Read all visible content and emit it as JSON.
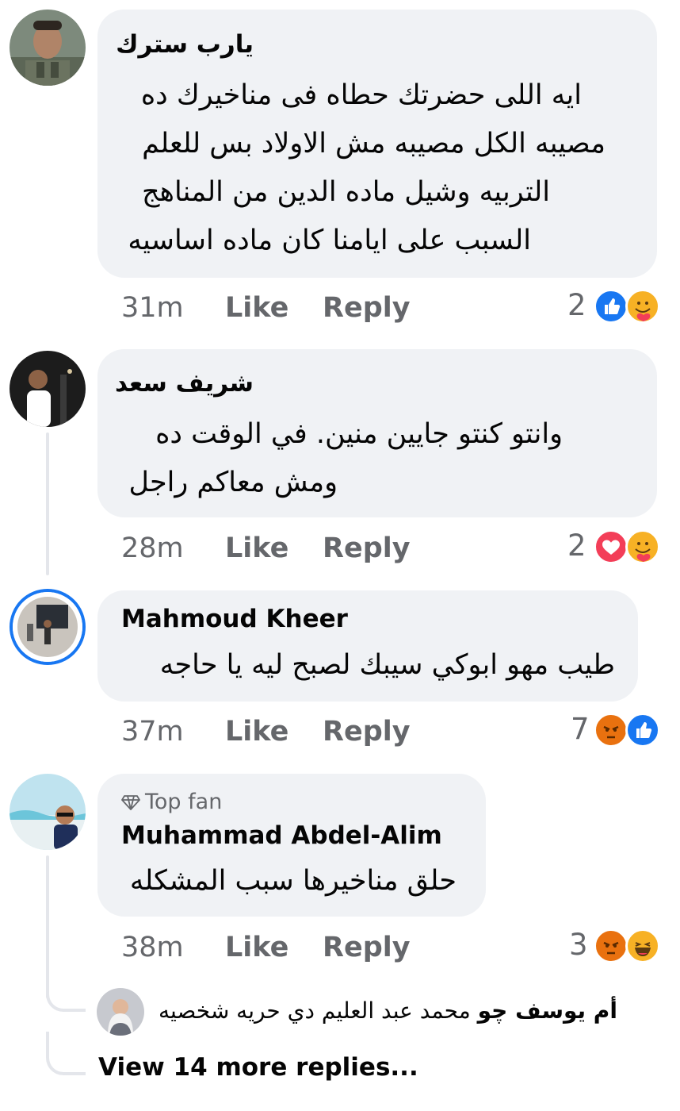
{
  "comments": [
    {
      "author": "يارب سترك",
      "lines": [
        "ايه اللى حضرتك حطاه فى مناخيرك ده",
        "مصيبه الكل مصيبه مش الاولاد بس للعلم",
        "التربيه وشيل ماده الدين من المناهج",
        "السبب على ايامنا كان ماده اساسيه"
      ],
      "time": "31m",
      "like_label": "Like",
      "reply_label": "Reply",
      "reaction_count": "2",
      "reactions": [
        "like-icon",
        "care-icon"
      ]
    },
    {
      "author": "شريف سعد",
      "lines": [
        "وانتو كنتو جايين منين. في الوقت ده",
        "ومش معاكم راجل"
      ],
      "time": "28m",
      "like_label": "Like",
      "reply_label": "Reply",
      "reaction_count": "2",
      "reactions": [
        "love-icon",
        "care-icon"
      ]
    },
    {
      "author": "Mahmoud Kheer",
      "lines": [
        "طيب مهو ابوكي سيبك لصبح ليه يا حاجه"
      ],
      "time": "37m",
      "like_label": "Like",
      "reply_label": "Reply",
      "reaction_count": "7",
      "reactions": [
        "angry-icon",
        "like-icon"
      ]
    },
    {
      "badge": "Top fan",
      "author": "Muhammad Abdel-Alim",
      "lines": [
        "حلق مناخيرها سبب المشكله"
      ],
      "time": "38m",
      "like_label": "Like",
      "reply_label": "Reply",
      "reaction_count": "3",
      "reactions": [
        "angry-icon",
        "haha-icon"
      ]
    }
  ],
  "reply_preview": {
    "author": "أم يوسف چو",
    "text": "محمد عبد العليم دي حريه شخصيه"
  },
  "view_more_label": "View 14 more replies...",
  "colors": {
    "bubble": "#f0f2f5",
    "meta": "#65676b",
    "like_blue": "#1877f2",
    "love_red": "#f33e58",
    "angry": "#e9710f",
    "thread": "#e4e6eb"
  }
}
